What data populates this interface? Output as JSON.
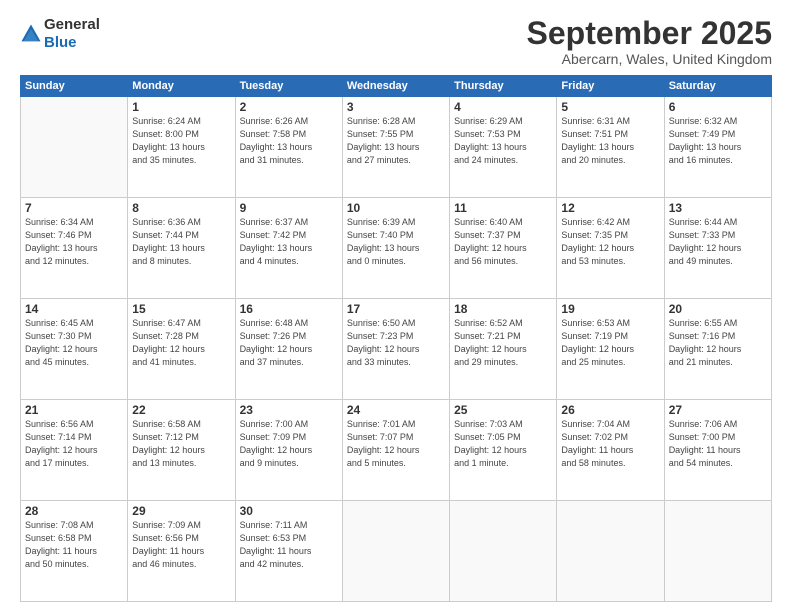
{
  "header": {
    "logo": {
      "general": "General",
      "blue": "Blue"
    },
    "title": "September 2025",
    "location": "Abercarn, Wales, United Kingdom"
  },
  "weekdays": [
    "Sunday",
    "Monday",
    "Tuesday",
    "Wednesday",
    "Thursday",
    "Friday",
    "Saturday"
  ],
  "weeks": [
    [
      {
        "day": "",
        "info": ""
      },
      {
        "day": "1",
        "info": "Sunrise: 6:24 AM\nSunset: 8:00 PM\nDaylight: 13 hours\nand 35 minutes."
      },
      {
        "day": "2",
        "info": "Sunrise: 6:26 AM\nSunset: 7:58 PM\nDaylight: 13 hours\nand 31 minutes."
      },
      {
        "day": "3",
        "info": "Sunrise: 6:28 AM\nSunset: 7:55 PM\nDaylight: 13 hours\nand 27 minutes."
      },
      {
        "day": "4",
        "info": "Sunrise: 6:29 AM\nSunset: 7:53 PM\nDaylight: 13 hours\nand 24 minutes."
      },
      {
        "day": "5",
        "info": "Sunrise: 6:31 AM\nSunset: 7:51 PM\nDaylight: 13 hours\nand 20 minutes."
      },
      {
        "day": "6",
        "info": "Sunrise: 6:32 AM\nSunset: 7:49 PM\nDaylight: 13 hours\nand 16 minutes."
      }
    ],
    [
      {
        "day": "7",
        "info": "Sunrise: 6:34 AM\nSunset: 7:46 PM\nDaylight: 13 hours\nand 12 minutes."
      },
      {
        "day": "8",
        "info": "Sunrise: 6:36 AM\nSunset: 7:44 PM\nDaylight: 13 hours\nand 8 minutes."
      },
      {
        "day": "9",
        "info": "Sunrise: 6:37 AM\nSunset: 7:42 PM\nDaylight: 13 hours\nand 4 minutes."
      },
      {
        "day": "10",
        "info": "Sunrise: 6:39 AM\nSunset: 7:40 PM\nDaylight: 13 hours\nand 0 minutes."
      },
      {
        "day": "11",
        "info": "Sunrise: 6:40 AM\nSunset: 7:37 PM\nDaylight: 12 hours\nand 56 minutes."
      },
      {
        "day": "12",
        "info": "Sunrise: 6:42 AM\nSunset: 7:35 PM\nDaylight: 12 hours\nand 53 minutes."
      },
      {
        "day": "13",
        "info": "Sunrise: 6:44 AM\nSunset: 7:33 PM\nDaylight: 12 hours\nand 49 minutes."
      }
    ],
    [
      {
        "day": "14",
        "info": "Sunrise: 6:45 AM\nSunset: 7:30 PM\nDaylight: 12 hours\nand 45 minutes."
      },
      {
        "day": "15",
        "info": "Sunrise: 6:47 AM\nSunset: 7:28 PM\nDaylight: 12 hours\nand 41 minutes."
      },
      {
        "day": "16",
        "info": "Sunrise: 6:48 AM\nSunset: 7:26 PM\nDaylight: 12 hours\nand 37 minutes."
      },
      {
        "day": "17",
        "info": "Sunrise: 6:50 AM\nSunset: 7:23 PM\nDaylight: 12 hours\nand 33 minutes."
      },
      {
        "day": "18",
        "info": "Sunrise: 6:52 AM\nSunset: 7:21 PM\nDaylight: 12 hours\nand 29 minutes."
      },
      {
        "day": "19",
        "info": "Sunrise: 6:53 AM\nSunset: 7:19 PM\nDaylight: 12 hours\nand 25 minutes."
      },
      {
        "day": "20",
        "info": "Sunrise: 6:55 AM\nSunset: 7:16 PM\nDaylight: 12 hours\nand 21 minutes."
      }
    ],
    [
      {
        "day": "21",
        "info": "Sunrise: 6:56 AM\nSunset: 7:14 PM\nDaylight: 12 hours\nand 17 minutes."
      },
      {
        "day": "22",
        "info": "Sunrise: 6:58 AM\nSunset: 7:12 PM\nDaylight: 12 hours\nand 13 minutes."
      },
      {
        "day": "23",
        "info": "Sunrise: 7:00 AM\nSunset: 7:09 PM\nDaylight: 12 hours\nand 9 minutes."
      },
      {
        "day": "24",
        "info": "Sunrise: 7:01 AM\nSunset: 7:07 PM\nDaylight: 12 hours\nand 5 minutes."
      },
      {
        "day": "25",
        "info": "Sunrise: 7:03 AM\nSunset: 7:05 PM\nDaylight: 12 hours\nand 1 minute."
      },
      {
        "day": "26",
        "info": "Sunrise: 7:04 AM\nSunset: 7:02 PM\nDaylight: 11 hours\nand 58 minutes."
      },
      {
        "day": "27",
        "info": "Sunrise: 7:06 AM\nSunset: 7:00 PM\nDaylight: 11 hours\nand 54 minutes."
      }
    ],
    [
      {
        "day": "28",
        "info": "Sunrise: 7:08 AM\nSunset: 6:58 PM\nDaylight: 11 hours\nand 50 minutes."
      },
      {
        "day": "29",
        "info": "Sunrise: 7:09 AM\nSunset: 6:56 PM\nDaylight: 11 hours\nand 46 minutes."
      },
      {
        "day": "30",
        "info": "Sunrise: 7:11 AM\nSunset: 6:53 PM\nDaylight: 11 hours\nand 42 minutes."
      },
      {
        "day": "",
        "info": ""
      },
      {
        "day": "",
        "info": ""
      },
      {
        "day": "",
        "info": ""
      },
      {
        "day": "",
        "info": ""
      }
    ]
  ]
}
